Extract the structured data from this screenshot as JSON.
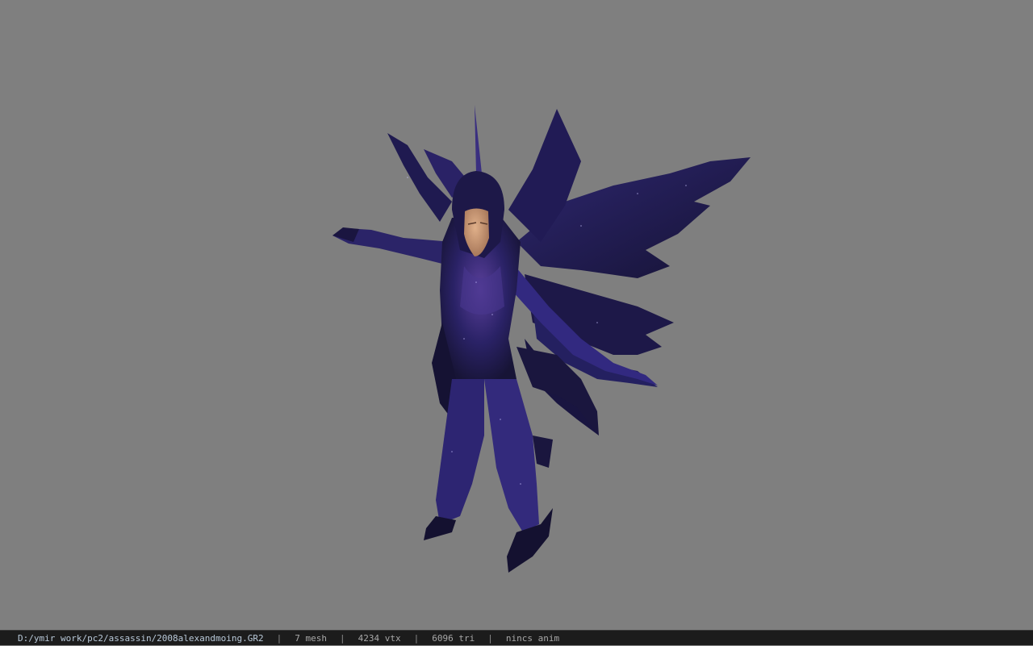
{
  "viewer": {
    "background_color": "#7f7f7f",
    "model_colors": {
      "armor_dark": "#171436",
      "armor_mid": "#2a2266",
      "armor_light": "#5a3f9a",
      "skin": "#c7956f"
    }
  },
  "statusbar": {
    "file_path": "D:/ymir work/pc2/assassin/2008alexandmoing.GR2",
    "separator": "|",
    "mesh_count": "7 mesh",
    "vertex_count": "4234 vtx",
    "triangle_count": "6096 tri",
    "animation_status": "nincs anim"
  }
}
